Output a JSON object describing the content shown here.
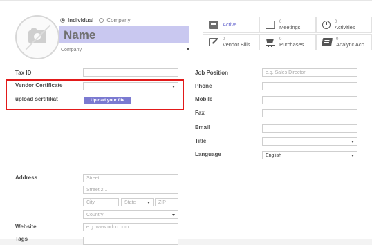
{
  "contact": {
    "type_options": [
      "Individual",
      "Company"
    ],
    "selected_type": "Individual",
    "name": "Name",
    "company_placeholder": "Company"
  },
  "smart_buttons": {
    "active": "Active",
    "meetings": {
      "count": "0",
      "label": "Meetings"
    },
    "activities": {
      "count": "0",
      "label": "Activities"
    },
    "vendor_bills": {
      "count": "0",
      "label": "Vendor Bills"
    },
    "purchases": {
      "count": "0",
      "label": "Purchases"
    },
    "analytic": {
      "count": "0",
      "label": "Analytic Acc..."
    }
  },
  "left_fields": {
    "tax_id": "Tax ID",
    "vendor_certificate": "Vendor Certificate",
    "upload_sertifikat": "upload sertifikat",
    "upload_button": "Upload your file"
  },
  "right_fields": {
    "job_position": "Job Position",
    "job_position_placeholder": "e.g. Sales Director",
    "phone": "Phone",
    "mobile": "Mobile",
    "fax": "Fax",
    "email": "Email",
    "title": "Title",
    "language": "Language",
    "language_value": "English"
  },
  "address": {
    "label": "Address",
    "street_placeholder": "Street...",
    "street2_placeholder": "Street 2...",
    "city_placeholder": "City",
    "state_placeholder": "State",
    "zip_placeholder": "ZIP",
    "country_placeholder": "Country"
  },
  "website": {
    "label": "Website",
    "placeholder": "e.g. www.odoo.com"
  },
  "tags": {
    "label": "Tags"
  },
  "colors": {
    "highlight": "#e21a1a",
    "name_bg": "#c9c8f0",
    "upload_bg": "#7b7ad1"
  }
}
